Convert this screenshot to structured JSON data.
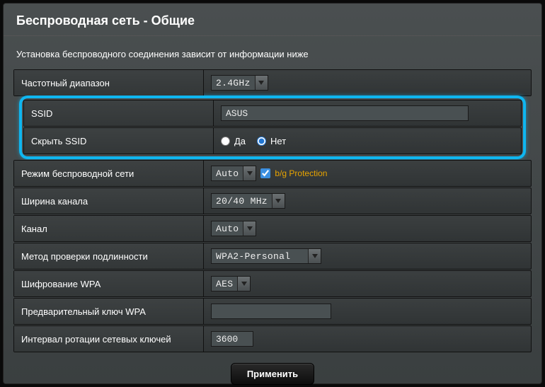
{
  "title": "Беспроводная сеть - Общие",
  "description": "Установка беспроводного соединения зависит от информации ниже",
  "rows": {
    "band": {
      "label": "Частотный диапазон",
      "value": "2.4GHz"
    },
    "ssid": {
      "label": "SSID",
      "value": "ASUS"
    },
    "hide_ssid": {
      "label": "Скрыть SSID",
      "yes": "Да",
      "no": "Нет",
      "selected": "no"
    },
    "mode": {
      "label": "Режим беспроводной сети",
      "value": "Auto",
      "bg_protection": "b/g Protection",
      "bg_checked": true
    },
    "width": {
      "label": "Ширина канала",
      "value": "20/40 MHz"
    },
    "channel": {
      "label": "Канал",
      "value": "Auto"
    },
    "auth": {
      "label": "Метод проверки подлинности",
      "value": "WPA2-Personal"
    },
    "encrypt": {
      "label": "Шифрование WPA",
      "value": "AES"
    },
    "psk": {
      "label": "Предварительный ключ WPA",
      "value": ""
    },
    "rekey": {
      "label": "Интервал ротации сетевых ключей",
      "value": "3600"
    }
  },
  "apply": "Применить"
}
